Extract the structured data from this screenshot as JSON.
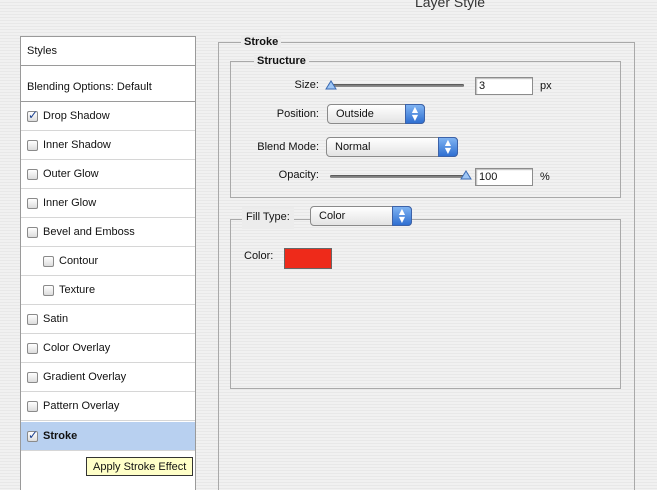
{
  "window": {
    "title": "Layer Style"
  },
  "sidebar": {
    "items": [
      {
        "label": "Styles",
        "type": "header"
      },
      {
        "label": "Blending Options: Default",
        "type": "header"
      },
      {
        "label": "Drop Shadow",
        "checked": true
      },
      {
        "label": "Inner Shadow",
        "checked": false
      },
      {
        "label": "Outer Glow",
        "checked": false
      },
      {
        "label": "Inner Glow",
        "checked": false
      },
      {
        "label": "Bevel and Emboss",
        "checked": false
      },
      {
        "label": "Contour",
        "checked": false,
        "sub": true
      },
      {
        "label": "Texture",
        "checked": false,
        "sub": true
      },
      {
        "label": "Satin",
        "checked": false
      },
      {
        "label": "Color Overlay",
        "checked": false
      },
      {
        "label": "Gradient Overlay",
        "checked": false
      },
      {
        "label": "Pattern Overlay",
        "checked": false
      },
      {
        "label": "Stroke",
        "checked": true,
        "selected": true
      }
    ],
    "tooltip": "Apply Stroke Effect"
  },
  "stroke": {
    "group_label": "Stroke",
    "structure_label": "Structure",
    "size": {
      "label": "Size:",
      "value": "3",
      "unit": "px",
      "slider_fraction": 0.02
    },
    "position": {
      "label": "Position:",
      "value": "Outside"
    },
    "blend_mode": {
      "label": "Blend Mode:",
      "value": "Normal"
    },
    "opacity": {
      "label": "Opacity:",
      "value": "100",
      "unit": "%",
      "slider_fraction": 1.0
    },
    "fill_type": {
      "label": "Fill Type:",
      "value": "Color"
    },
    "color": {
      "label": "Color:",
      "swatch": "#ee2a1a"
    }
  }
}
